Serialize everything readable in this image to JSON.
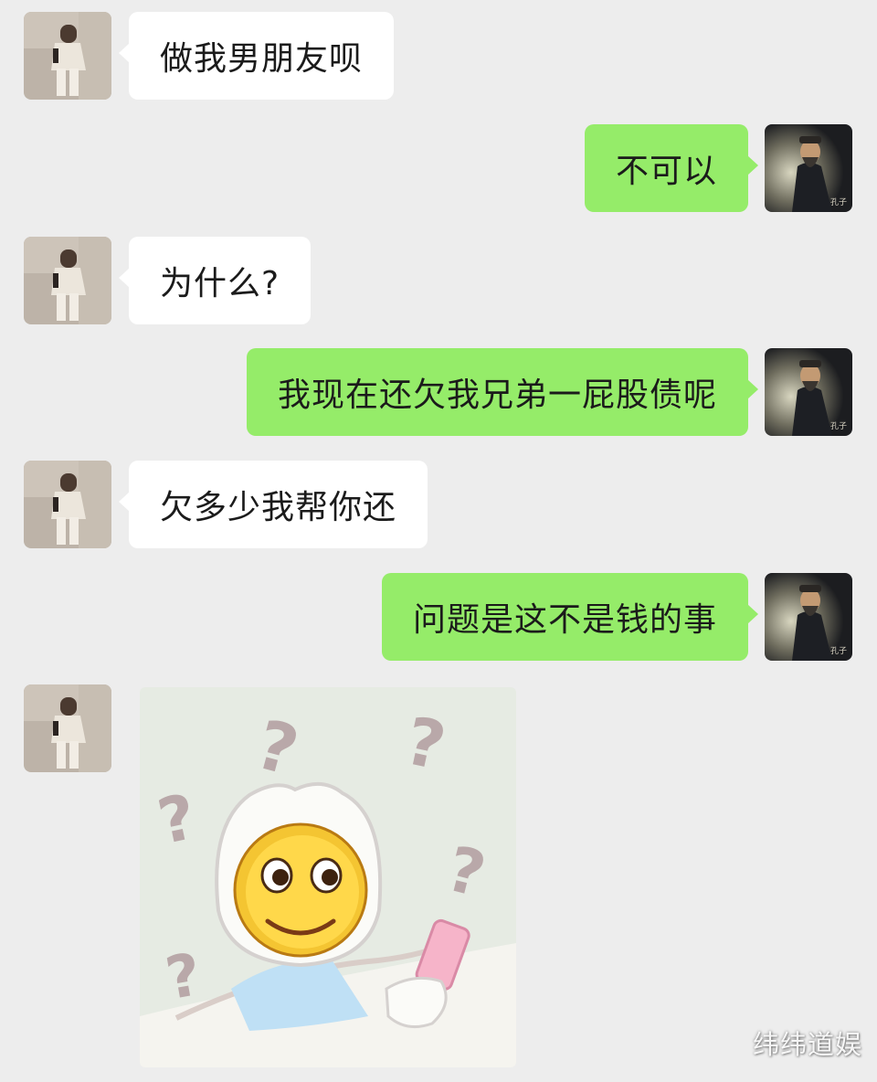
{
  "conversation": {
    "messages": [
      {
        "side": "left",
        "sender": "female-avatar",
        "text": "做我男朋友呗"
      },
      {
        "side": "right",
        "sender": "confucius-avatar",
        "text": "不可以"
      },
      {
        "side": "left",
        "sender": "female-avatar",
        "text": "为什么?"
      },
      {
        "side": "right",
        "sender": "confucius-avatar",
        "text": "我现在还欠我兄弟一屁股债呢"
      },
      {
        "side": "left",
        "sender": "female-avatar",
        "text": "欠多少我帮你还"
      },
      {
        "side": "right",
        "sender": "confucius-avatar",
        "text": "问题是这不是钱的事"
      }
    ],
    "sticker": {
      "sender": "female-avatar",
      "description": "confused-smiley-with-phone-sticker",
      "glyphs": [
        "?",
        "?",
        "?",
        "?",
        "?"
      ]
    }
  },
  "avatars": {
    "confucius_caption": "孔子"
  },
  "watermark": "纬纬道娱",
  "colors": {
    "background": "#ededed",
    "incoming_bubble": "#ffffff",
    "outgoing_bubble": "#95ec69",
    "text": "#1b1b1b"
  }
}
